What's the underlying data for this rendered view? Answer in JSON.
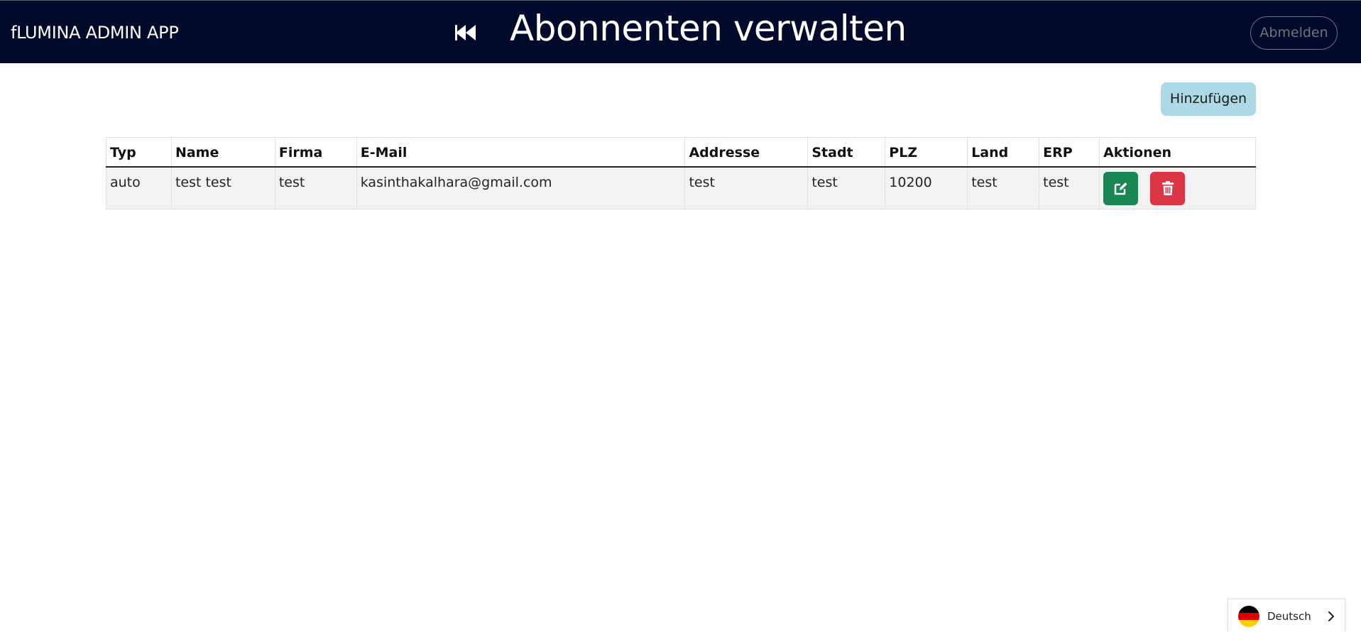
{
  "header": {
    "brand": "fLUMINA ADMIN APP",
    "title": "Abonnenten verwalten",
    "logout_label": "Abmelden",
    "background_color": "#010a2b"
  },
  "toolbar": {
    "add_label": "Hinzufügen"
  },
  "table": {
    "columns": [
      "Typ",
      "Name",
      "Firma",
      "E-Mail",
      "Addresse",
      "Stadt",
      "PLZ",
      "Land",
      "ERP",
      "Aktionen"
    ],
    "rows": [
      {
        "typ": "auto",
        "name": "test test",
        "firma": "test",
        "email": "kasinthakalhara@gmail.com",
        "addresse": "test",
        "stadt": "test",
        "plz": "10200",
        "land": "test",
        "erp": "test"
      }
    ]
  },
  "actions": {
    "edit_icon": "edit-icon",
    "delete_icon": "trash-icon",
    "edit_color": "#198754",
    "delete_color": "#dc3545"
  },
  "language": {
    "label": "Deutsch",
    "flag": "germany-flag-icon"
  }
}
